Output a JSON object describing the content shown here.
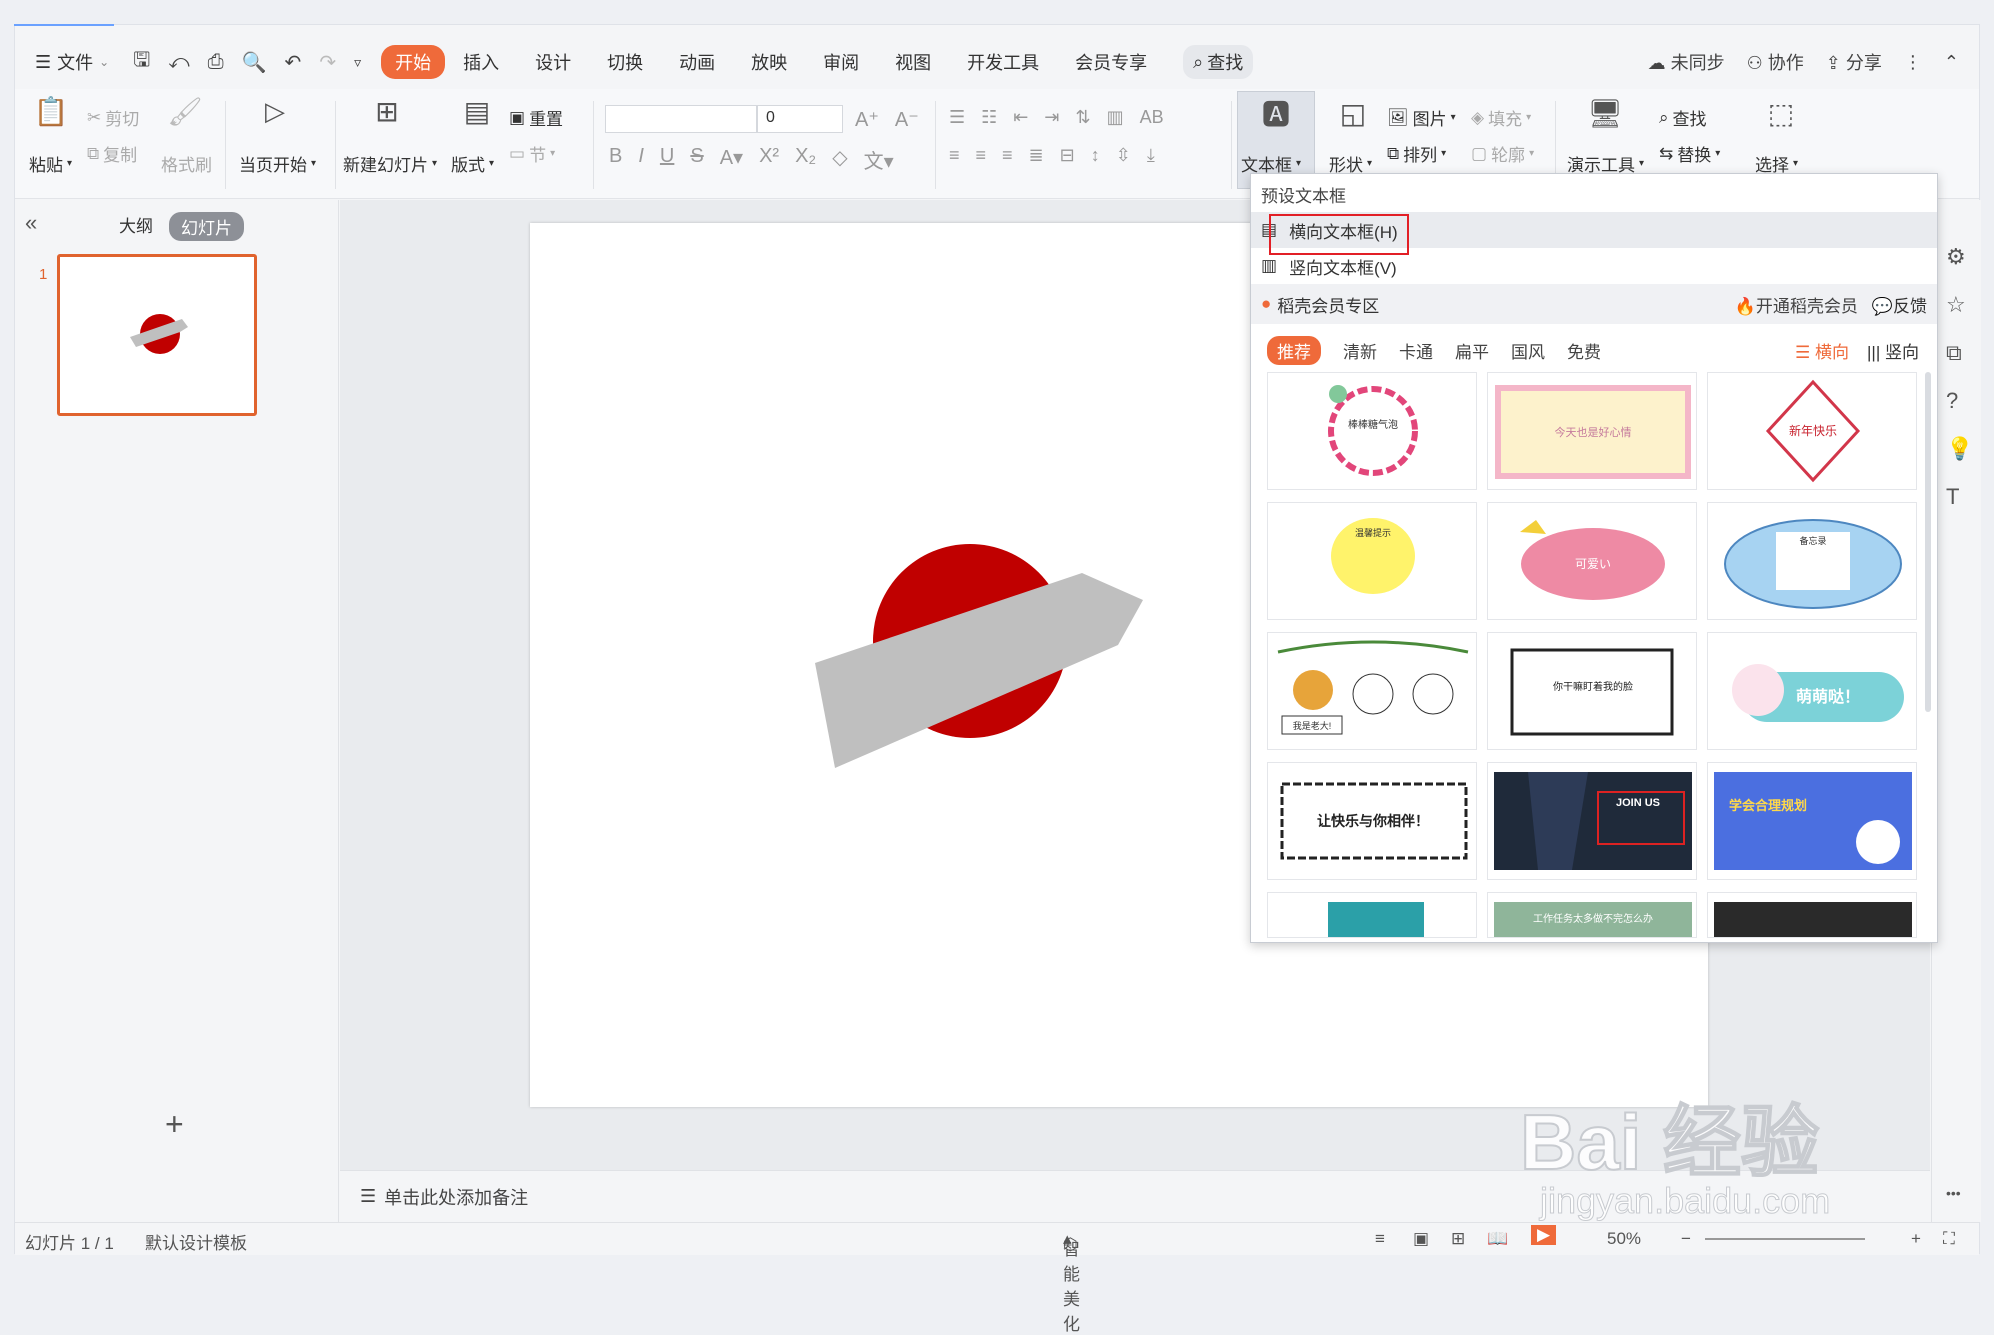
{
  "menu": {
    "file": "文件",
    "tabs": [
      "开始",
      "插入",
      "设计",
      "切换",
      "动画",
      "放映",
      "审阅",
      "视图",
      "开发工具",
      "会员专享"
    ],
    "search": "查找",
    "right": [
      "未同步",
      "协作",
      "分享"
    ]
  },
  "ribbon": {
    "paste": "粘贴",
    "cut": "剪切",
    "copy": "复制",
    "format_painter": "格式刷",
    "start_slideshow": "当页开始",
    "new_slide": "新建幻灯片",
    "layout": "版式",
    "reset": "重置",
    "section": "节",
    "font_size": "0",
    "textbox": "文本框",
    "shape": "形状",
    "picture": "图片",
    "fill": "填充",
    "arrange": "排列",
    "outline": "轮廓",
    "presenter_tools": "演示工具",
    "find": "查找",
    "replace": "替换",
    "select": "选择"
  },
  "left_panel": {
    "outline_tab": "大纲",
    "slides_tab": "幻灯片",
    "slide_number": "1"
  },
  "notes_placeholder": "单击此处添加备注",
  "status": {
    "slide_counter": "幻灯片 1 / 1",
    "template": "默认设计模板",
    "smart_beautify": "智能美化",
    "zoom": "50%"
  },
  "dropdown": {
    "header": "预设文本框",
    "items": [
      "横向文本框(H)",
      "竖向文本框(V)"
    ],
    "vip_zone": "稻壳会员专区",
    "vip_open": "开通稻壳会员",
    "feedback": "反馈",
    "filters": [
      "推荐",
      "清新",
      "卡通",
      "扁平",
      "国风",
      "免费"
    ],
    "orient_h": "横向",
    "orient_v": "竖向",
    "card_texts": [
      "棒棒糖气泡",
      "今天也是好心情",
      "新年快乐",
      "温馨提示",
      "可爱い",
      "备忘录",
      "我是老大!",
      "你干嘛盯着我的脸",
      "萌萌哒！",
      "让快乐与你相伴！",
      "JOIN US",
      "学会合理规划",
      "工作任务太多做不完怎么办"
    ]
  },
  "watermark": {
    "main": "Bai 经验",
    "sub": "jingyan.baidu.com"
  },
  "colors": {
    "accent": "#ef6a3a",
    "slide_red": "#c00000",
    "shape_gray": "#bfbfbf"
  }
}
